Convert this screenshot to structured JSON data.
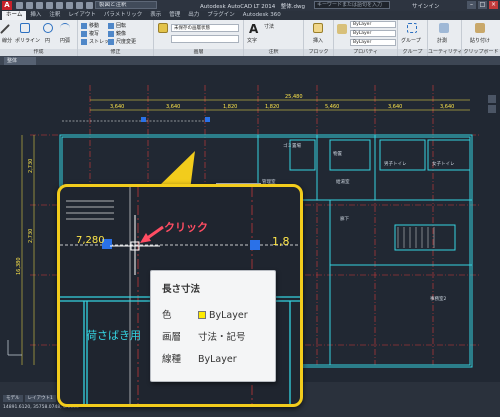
{
  "titlebar": {
    "workspace": "製図と注釈",
    "app_title": "Autodesk AutoCAD LT 2014　整体.dwg",
    "search_placeholder": "キーワードまたは語句を入力",
    "signin": "サインイン"
  },
  "ribbon_tabs": [
    "ホーム",
    "挿入",
    "注釈",
    "レイアウト",
    "パラメトリック",
    "表示",
    "管理",
    "出力",
    "プラグイン",
    "Autodesk 360"
  ],
  "ribbon": {
    "panels": [
      {
        "title": "作成",
        "buttons": [
          "線分",
          "ポリライン",
          "円",
          "円弧"
        ]
      },
      {
        "title": "修正",
        "buttons": [
          "移動",
          "回転",
          "トリム",
          "複写",
          "鏡像",
          "フィレット",
          "ストレッチ",
          "尺度変更",
          "配列複写"
        ]
      },
      {
        "title": "画層",
        "buttons": [
          "画層プロパティ",
          "未保存の画層状態"
        ]
      },
      {
        "title": "注釈",
        "buttons": [
          "文字",
          "寸法記入",
          "寸法"
        ]
      },
      {
        "title": "ブロック",
        "buttons": [
          "挿入"
        ]
      },
      {
        "title": "プロパティ",
        "buttons": [
          "プロパティコピー",
          "ByLayer",
          "ByLayer",
          "ByLayer"
        ]
      },
      {
        "title": "グループ",
        "buttons": [
          "グループ"
        ]
      },
      {
        "title": "ユーティリティ",
        "buttons": [
          "計測"
        ]
      },
      {
        "title": "クリップボード",
        "buttons": [
          "貼り付け"
        ]
      }
    ]
  },
  "file_tab": "整体",
  "drawing": {
    "dims_top": [
      "3,640",
      "3,640",
      "1,820",
      "1,820",
      "5,460",
      "3,640",
      "3,640",
      "3,640",
      "3,640"
    ],
    "dim_total": "25,480",
    "dims_left": [
      "2,730",
      "2,730",
      "2,730",
      "2,730",
      "2,730"
    ],
    "dim_left_total": "16,380",
    "room_labels": [
      "ゴミ置場",
      "物置",
      "給湯室",
      "管理室",
      "男子トイレ",
      "女子トイレ",
      "廊下",
      "荷さばき用",
      "事務室2"
    ]
  },
  "mini_tooltip": {
    "title": "長さ寸法",
    "rows": [
      {
        "key": "色",
        "value": "ByLayer"
      },
      {
        "key": "画層",
        "value": "寸法・記号"
      },
      {
        "key": "線種",
        "value": "ByLayer"
      }
    ]
  },
  "zoom": {
    "click_label": "クリック",
    "dim_left": "7,280",
    "dim_right": "1,8",
    "room_label": "荷さばき用"
  },
  "tooltip": {
    "title": "長さ寸法",
    "color_key": "色",
    "color_value": "ByLayer",
    "layer_key": "画層",
    "layer_value": "寸法・記号",
    "linetype_key": "線種",
    "linetype_value": "ByLayer"
  },
  "status": {
    "coords": "14891.6120, 35758.0748, 0.0000",
    "layout_tabs": [
      "モデル",
      "レイアウト1",
      "レイアウト2"
    ]
  },
  "colors": {
    "accent_callout": "#f2cc1c",
    "wall_cyan": "#35d3e0",
    "dim_yellow": "#ffe74a",
    "click_red": "#ff4d63",
    "layer_yellow": "#ffeb00"
  }
}
